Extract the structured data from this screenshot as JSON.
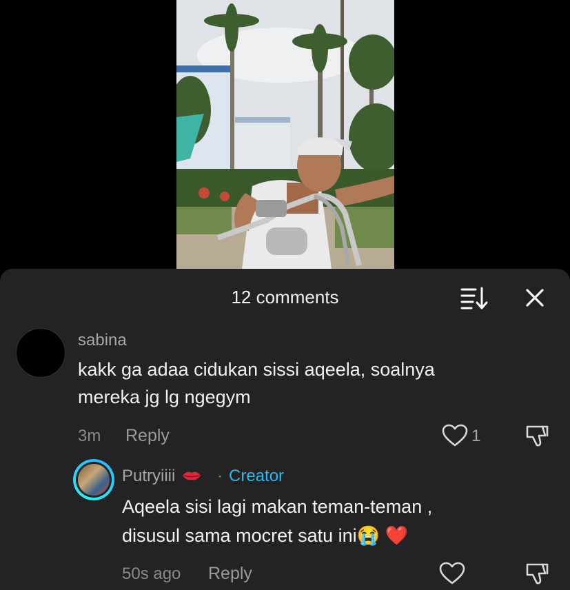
{
  "header": {
    "comment_count_label": "12 comments"
  },
  "icons": {
    "sort": "sort-icon",
    "close": "close-icon",
    "like": "heart-icon",
    "dislike": "thumbs-down-icon",
    "lips": "kiss-lips-icon"
  },
  "colors": {
    "sheet_bg": "#232323",
    "creator_accent": "#2bb8f0"
  },
  "comments": [
    {
      "username": "sabina",
      "text_line1": "kakk ga adaa cidukan sissi aqeela, soalnya",
      "text_line2": "mereka jg lg ngegym",
      "time": "3m",
      "reply_label": "Reply",
      "like_count": "1"
    },
    {
      "username": "Putryiiii",
      "badge_separator": "·",
      "badge": "Creator",
      "text_line1": "Aqeela sisi lagi makan teman-teman ,",
      "text_line2": "disusul sama mocret satu ini",
      "text_emoji": "😭 ❤️",
      "time": "50s ago",
      "reply_label": "Reply"
    }
  ]
}
